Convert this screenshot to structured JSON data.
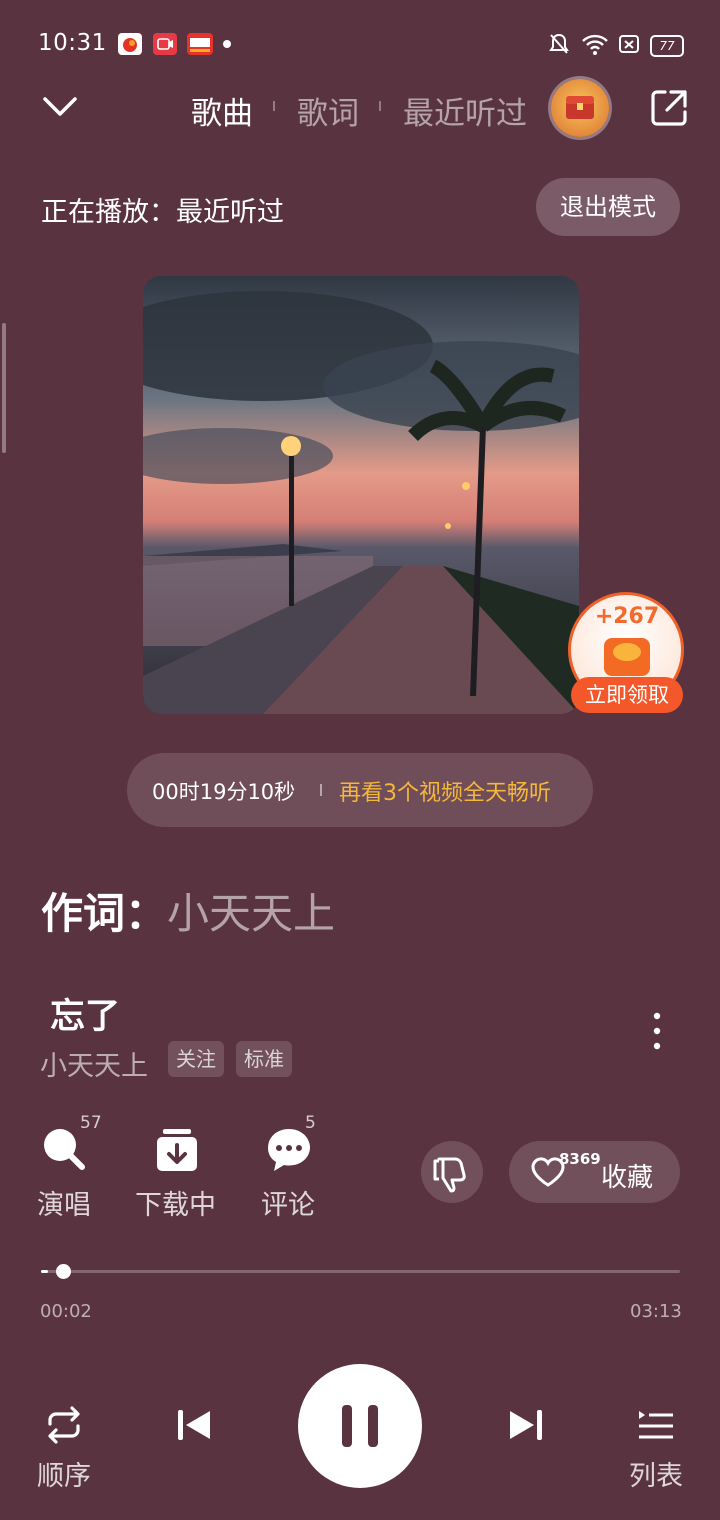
{
  "status_bar": {
    "time": "10:31",
    "battery": "77"
  },
  "top_nav": {
    "tabs": [
      {
        "label": "歌曲",
        "active": true
      },
      {
        "label": "歌词",
        "active": false
      },
      {
        "label": "最近听过",
        "active": false
      }
    ]
  },
  "mode_bar": {
    "now_playing": "正在播放：最近听过",
    "exit_label": "退出模式"
  },
  "reward": {
    "amount": "+267",
    "claim_label": "立即领取"
  },
  "timer": {
    "remaining": "00时19分10秒",
    "promo": "再看3个视频全天畅听"
  },
  "lyric_credit": {
    "key": "作词：",
    "value": "小天天上"
  },
  "song": {
    "title": "忘了",
    "artist": "小天天上",
    "follow_label": "关注",
    "quality_label": "标准"
  },
  "actions": {
    "sing": {
      "label": "演唱",
      "count": "57"
    },
    "download": {
      "label": "下载中"
    },
    "comment": {
      "label": "评论",
      "count": "5"
    },
    "favorite": {
      "label": "收藏",
      "count": "8369"
    }
  },
  "progress": {
    "current": "00:02",
    "duration": "03:13",
    "fraction": 0.0104
  },
  "controls": {
    "mode_label": "顺序",
    "list_label": "列表"
  },
  "colors": {
    "background": "#5a3341",
    "accent_orange": "#f4572a",
    "promo_yellow": "#f5b83a"
  }
}
